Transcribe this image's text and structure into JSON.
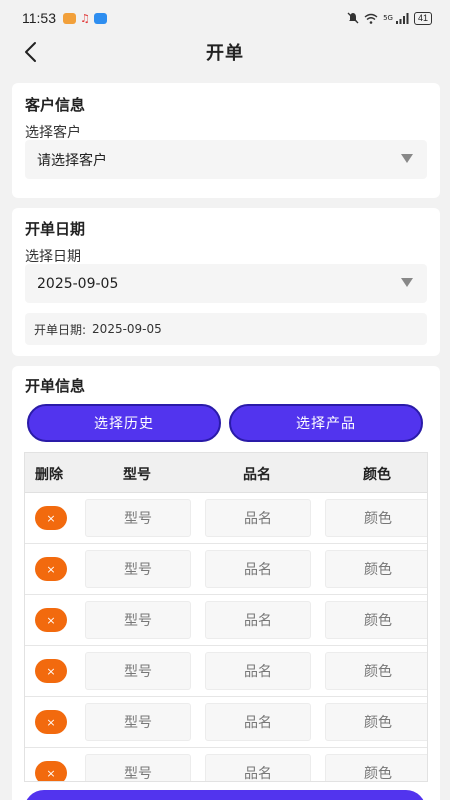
{
  "status_bar": {
    "time": "11:53",
    "battery": "41",
    "network": "5G"
  },
  "header": {
    "title": "开单"
  },
  "customer_section": {
    "title": "客户信息",
    "label": "选择客户",
    "placeholder": "请选择客户"
  },
  "date_section": {
    "title": "开单日期",
    "label": "选择日期",
    "value": "2025-09-05",
    "note_label": "开单日期:",
    "note_value": "2025-09-05"
  },
  "order_section": {
    "title": "开单信息",
    "history_button": "选择历史",
    "product_button": "选择产品",
    "columns": [
      "删除",
      "型号",
      "品名",
      "颜色"
    ],
    "delete_symbol": "×",
    "rows": [
      {
        "model": "型号",
        "name": "品名",
        "color": "颜色"
      },
      {
        "model": "型号",
        "name": "品名",
        "color": "颜色"
      },
      {
        "model": "型号",
        "name": "品名",
        "color": "颜色"
      },
      {
        "model": "型号",
        "name": "品名",
        "color": "颜色"
      },
      {
        "model": "型号",
        "name": "品名",
        "color": "颜色"
      },
      {
        "model": "型号",
        "name": "品名",
        "color": "颜色"
      }
    ]
  },
  "colors": {
    "accent": "#5234ee",
    "delete": "#f26a0e"
  }
}
